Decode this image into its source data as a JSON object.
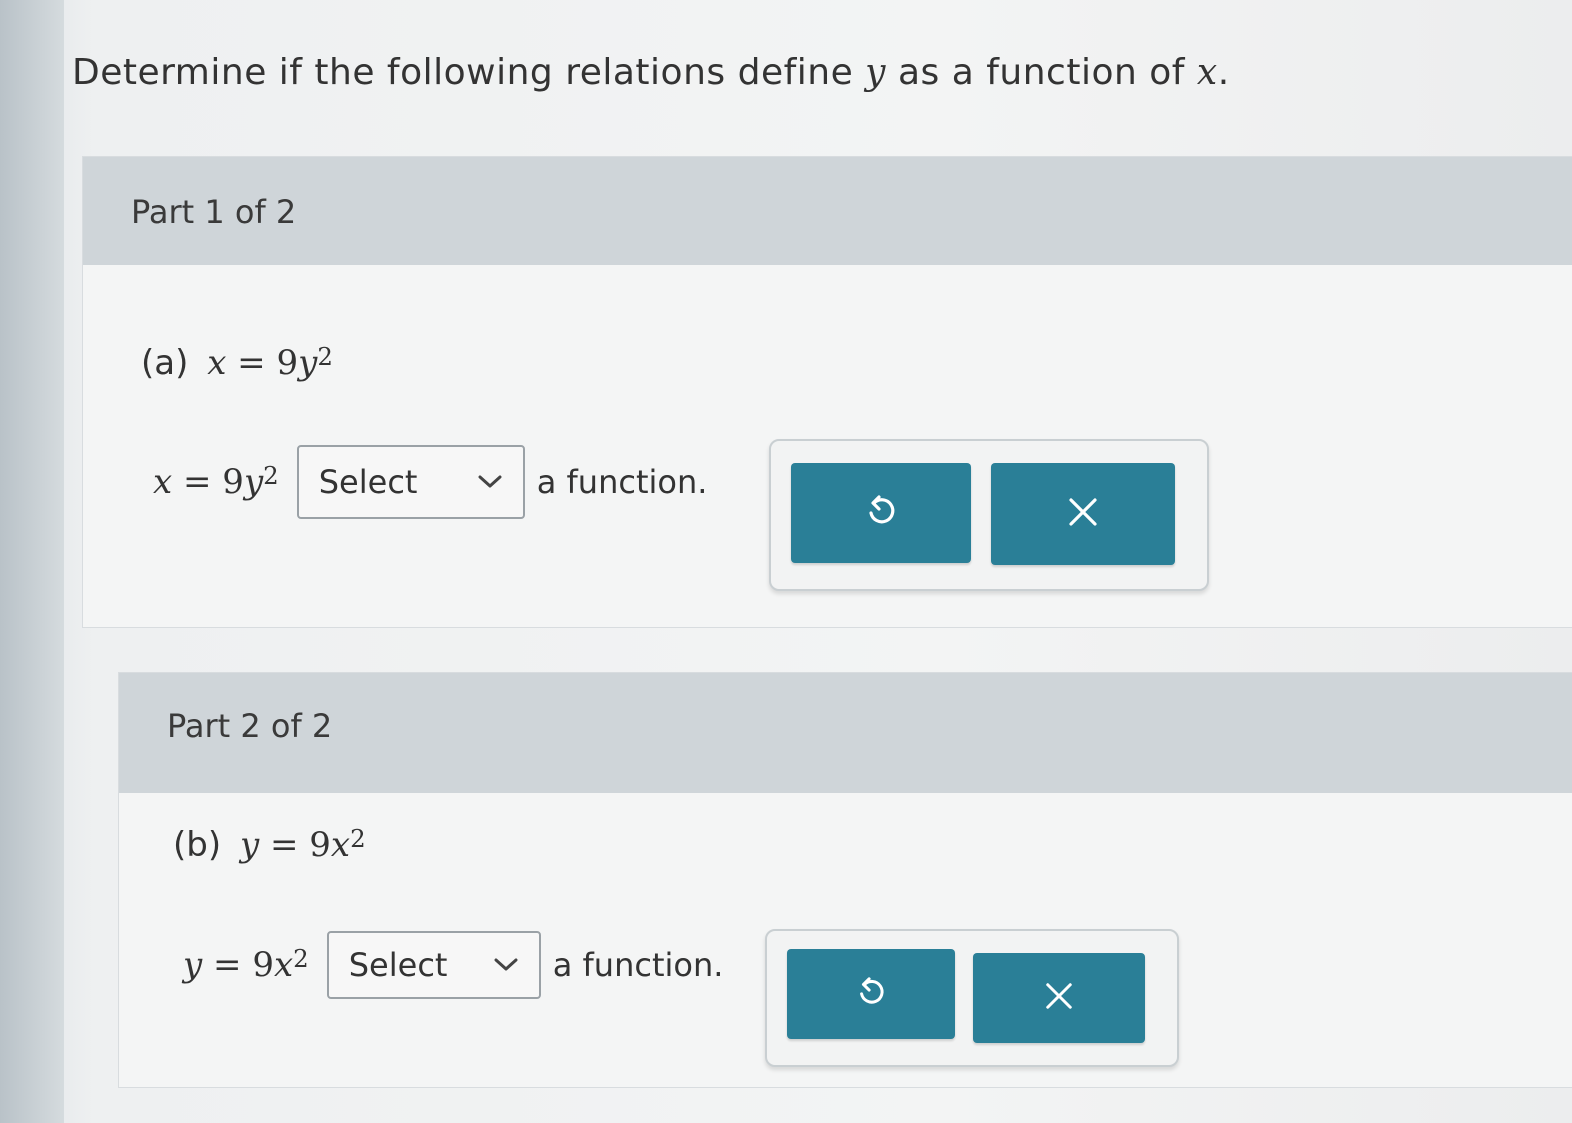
{
  "prompt": {
    "text": "Determine if the following relations define ",
    "var_y": "y",
    "middle": " as a function of ",
    "var_x": "x",
    "end": "."
  },
  "parts": [
    {
      "header": "Part 1 of 2",
      "question_label": "(a)",
      "equation": {
        "lhs": "x",
        "op": " = ",
        "coef": "9",
        "var": "y",
        "exp": "2"
      },
      "select_value": "Select",
      "after_text": "a function."
    },
    {
      "header": "Part 2 of 2",
      "question_label": "(b)",
      "equation": {
        "lhs": "y",
        "op": " = ",
        "coef": "9",
        "var": "x",
        "exp": "2"
      },
      "select_value": "Select",
      "after_text": "a function."
    }
  ],
  "icons": {
    "undo": "undo-icon",
    "clear": "close-icon",
    "dropdown": "chevron-down-icon"
  },
  "colors": {
    "button": "#2a7f97",
    "header": "#cfd5d9"
  }
}
